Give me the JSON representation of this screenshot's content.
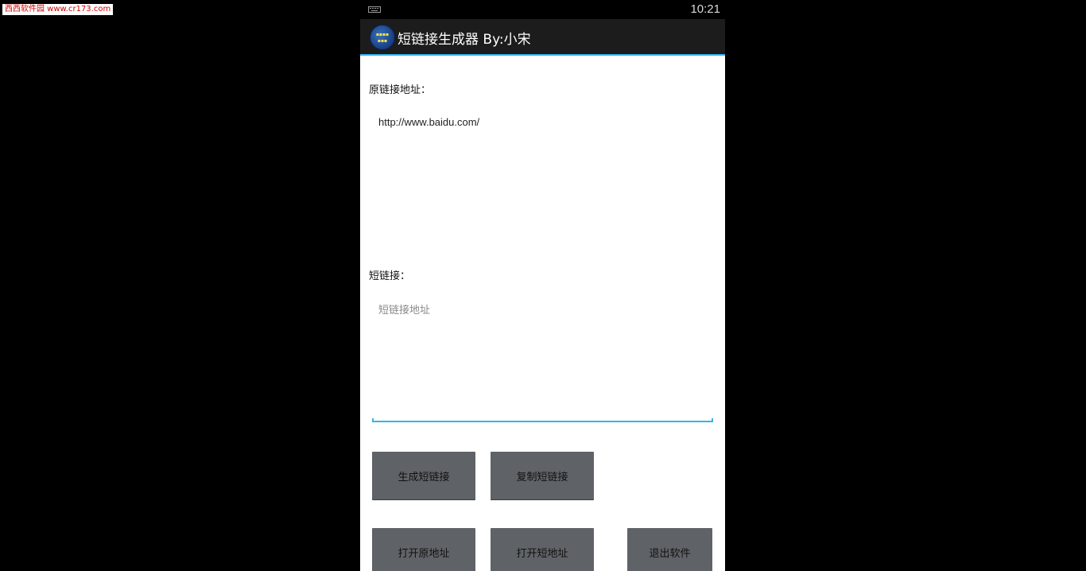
{
  "watermark": "西西软件园 www.cr173.com",
  "status_bar": {
    "time": "10:21",
    "keyboard_icon": "keyboard-icon"
  },
  "action_bar": {
    "title": "短链接生成器 By:小宋",
    "app_icon": "app-logo-icon"
  },
  "form": {
    "original_label": "原链接地址：",
    "original_value": "http://www.baidu.com/",
    "short_label": "短链接：",
    "short_placeholder": "短链接地址"
  },
  "buttons": {
    "generate": "生成短链接",
    "copy": "复制短链接",
    "open_original": "打开原地址",
    "open_short": "打开短地址",
    "exit": "退出软件"
  },
  "colors": {
    "accent": "#33b5e5",
    "button_bg": "#5f6367",
    "action_bar_bg": "#1c1c1c"
  }
}
